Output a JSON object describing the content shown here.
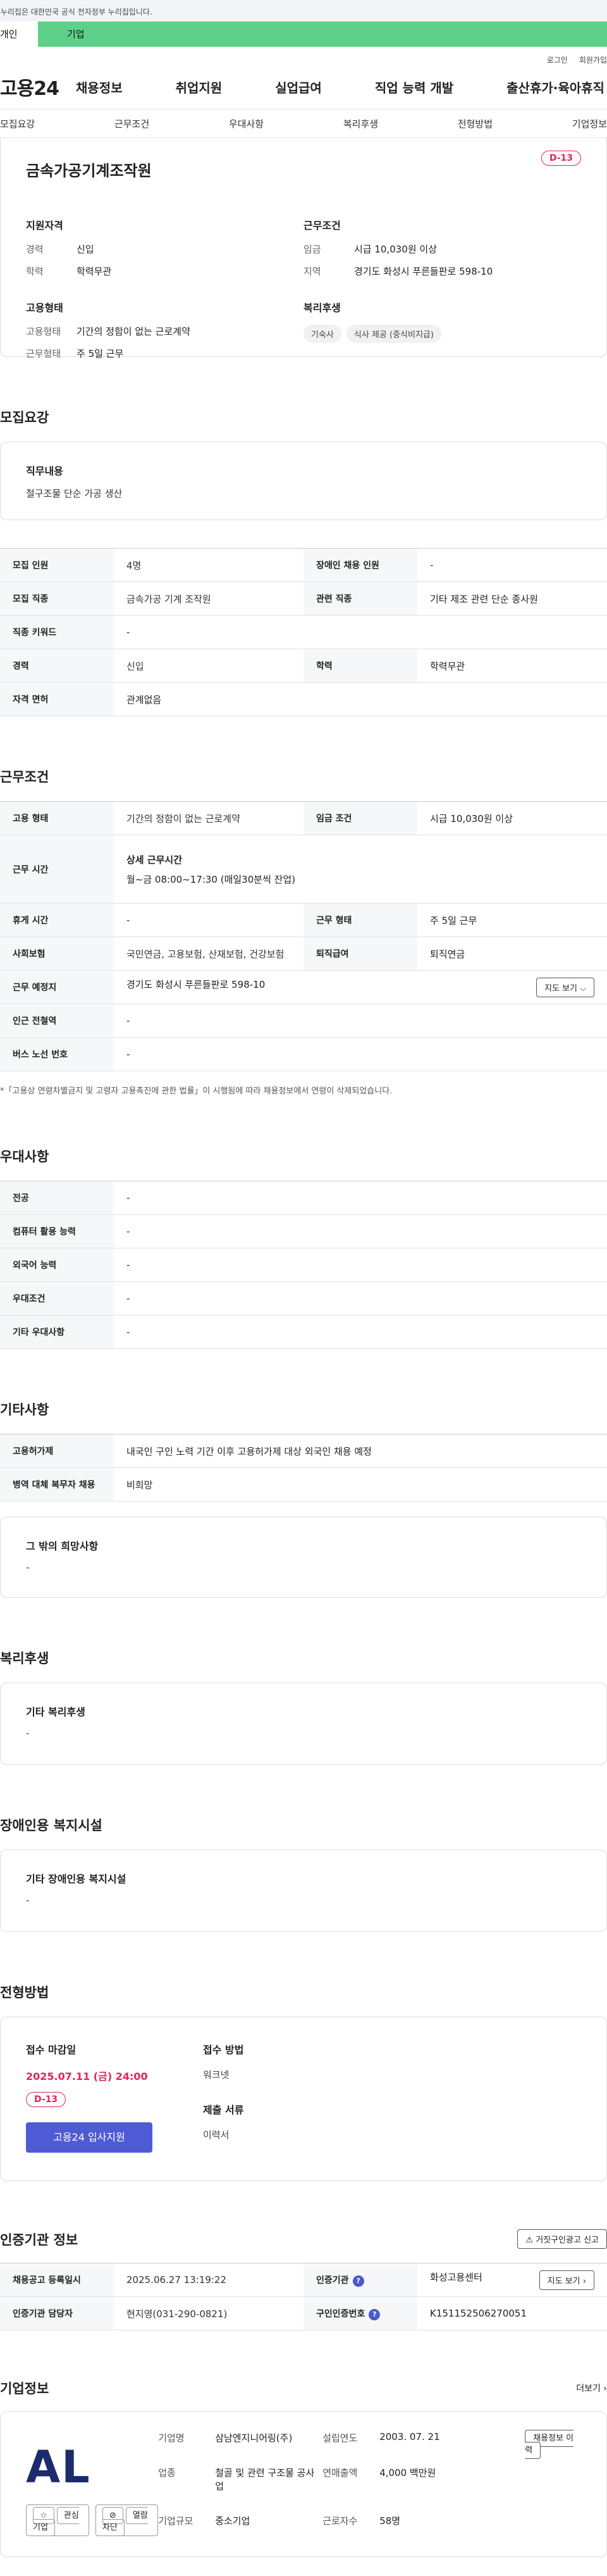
{
  "banner": "이 누리집은 대한민국 공식 전자정부 누리집입니다.",
  "tabs": [
    "개인",
    "기업"
  ],
  "util": [
    "로그인",
    "회원가입"
  ],
  "logo": "고용24",
  "gnb": [
    "채용정보",
    "취업지원",
    "실업급여",
    "직업 능력 개발",
    "출산휴가·육아휴직"
  ],
  "subnav": [
    "모집요강",
    "근무조건",
    "우대사항",
    "복리후생",
    "전형방법",
    "기업정보"
  ],
  "summary": {
    "title": "금속가공기계조작원",
    "dday": "D-13",
    "qual_title": "지원자격",
    "qual": [
      {
        "k": "경력",
        "v": "신입"
      },
      {
        "k": "학력",
        "v": "학력무관"
      }
    ],
    "cond_title": "근무조건",
    "cond": [
      {
        "k": "임금",
        "v": "시급 10,030원 이상"
      },
      {
        "k": "지역",
        "v": "경기도 화성시 푸른들판로 598-10"
      }
    ],
    "type_title": "고용형태",
    "type": [
      {
        "k": "고용형태",
        "v": "기간의 정함이 없는 근로계약"
      },
      {
        "k": "근무형태",
        "v": "주 5일 근무"
      }
    ],
    "welfare_title": "복리후생",
    "welfare": [
      "기숙사",
      "식사 제공 (중식비지급)"
    ]
  },
  "recruit": {
    "heading": "모집요강",
    "duty_label": "직무내용",
    "duty": "철구조물 단순 가공 생산",
    "rows": [
      [
        "모집 인원",
        "4명",
        "장애인 채용 인원",
        "-"
      ],
      [
        "모집 직종",
        "금속가공 기계 조작원",
        "관련 직종",
        "기타 제조 관련 단순 종사원"
      ],
      [
        "직종 키워드",
        "-"
      ],
      [
        "경력",
        "신입",
        "학력",
        "학력무관"
      ],
      [
        "자격 면허",
        "관계없음"
      ]
    ]
  },
  "work": {
    "heading": "근무조건",
    "r1": [
      "고용 형태",
      "기간의 정함이 없는 근로계약",
      "임금 조건",
      "시급 10,030원 이상"
    ],
    "time_k": "근무 시간",
    "time_label": "상세 근무시간",
    "time_v": "월~금 08:00~17:30 (매일30분씩 잔업)",
    "r3": [
      "휴게 시간",
      "-",
      "근무 형태",
      "주 5일 근무"
    ],
    "r4": [
      "사회보험",
      "국민연금, 고용보험, 산재보험, 건강보험",
      "퇴직급여",
      "퇴직연금"
    ],
    "addr_k": "근무 예정지",
    "addr_v": "경기도 화성시 푸른들판로 598-10",
    "map_btn": "지도 보기",
    "r6": [
      "인근 전철역",
      "-"
    ],
    "r7": [
      "버스 노선 번호",
      "-"
    ],
    "note": "*「고용상 연령차별금지 및 고령자 고용촉진에 관한 법률」이 시행됨에 따라 채용정보에서 연령이 삭제되었습니다."
  },
  "pref": {
    "heading": "우대사항",
    "rows": [
      [
        "전공",
        "-"
      ],
      [
        "컴퓨터 활용 능력",
        "-"
      ],
      [
        "외국어 능력",
        "-"
      ],
      [
        "우대조건",
        "-"
      ],
      [
        "기타 우대사항",
        "-"
      ]
    ]
  },
  "etc": {
    "heading": "기타사항",
    "rows": [
      [
        "고용허가제",
        "내국인 구인 노력 기간 이후 고용허가제 대상 외국인 채용 예정"
      ],
      [
        "병역 대체 복무자 채용",
        "비희망"
      ]
    ],
    "other_label": "그 밖의 희망사항",
    "other": "-"
  },
  "welfare": {
    "heading": "복리후생",
    "label": "기타 복리후생",
    "value": "-"
  },
  "disabled": {
    "heading": "장애인용 복지시설",
    "label": "기타 장애인용 복지시설",
    "value": "-"
  },
  "apply": {
    "heading": "전형방법",
    "deadline_label": "접수 마감일",
    "deadline": "2025.07.11 (금) 24:00",
    "dday": "D-13",
    "cta": "고용24 입사지원",
    "method_label": "접수 방법",
    "method": "워크넷",
    "docs_label": "제출 서류",
    "docs": "이력서"
  },
  "cert": {
    "heading": "인증기관 정보",
    "report_btn": "거짓구인광고 신고",
    "r1": [
      "채용공고 등록일시",
      "2025.06.27 13:19:22",
      "인증기관",
      "화성고용센터"
    ],
    "r2": [
      "인증기관 담당자",
      "현지영(031-290-0821)",
      "구인인증번호",
      "K151152506270051"
    ],
    "map_btn": "지도 보기"
  },
  "company": {
    "heading": "기업정보",
    "more": "더보기",
    "logo_text": "AL",
    "fav_btn": "관심기업",
    "block_btn": "열람차단",
    "hist_btn": "채용정보 이력",
    "name_k": "기업명",
    "name_v": "삼남엔지니어링(주)",
    "ind_k": "업종",
    "ind_v": "철골 및 관련 구조물 공사업",
    "size_k": "기업규모",
    "size_v": "중소기업",
    "est_k": "설립연도",
    "est_v": "2003. 07. 21",
    "sales_k": "연매출액",
    "sales_v": "4,000 백만원",
    "emp_k": "근로자수",
    "emp_v": "58명"
  }
}
